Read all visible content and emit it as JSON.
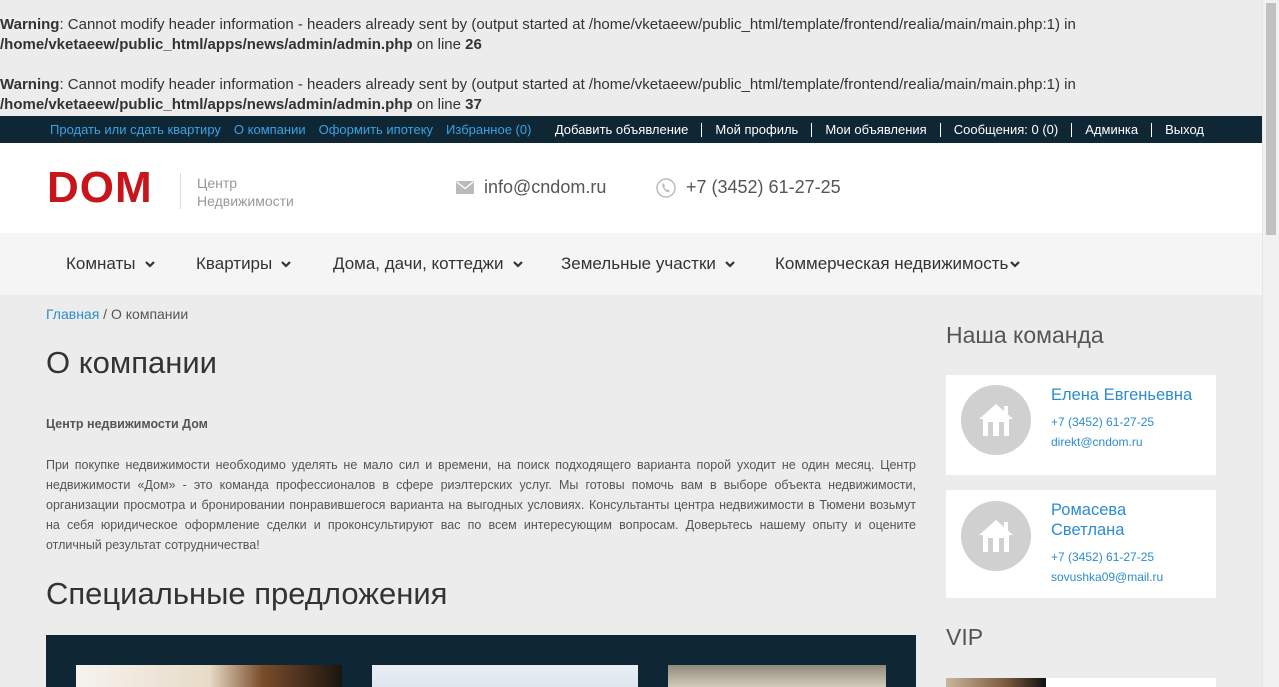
{
  "warnings": [
    {
      "label": "Warning",
      "text": ": Cannot modify header information - headers already sent by (output started at /home/vketaeew/public_html/template/frontend/realia/main/main.php:1) in",
      "path": "/home/vketaeew/public_html/apps/news/admin/admin.php",
      "line_prefix": " on line ",
      "line": "26"
    },
    {
      "label": "Warning",
      "text": ": Cannot modify header information - headers already sent by (output started at /home/vketaeew/public_html/template/frontend/realia/main/main.php:1) in",
      "path": "/home/vketaeew/public_html/apps/news/admin/admin.php",
      "line_prefix": " on line ",
      "line": "37"
    }
  ],
  "topbar": {
    "left_links": [
      "Продать или сдать квартиру",
      "О компании",
      "Оформить ипотеку",
      "Избранное (0)"
    ],
    "right_links": [
      "Добавить объявление",
      "Мой профиль",
      "Мои объявления",
      "Сообщения: 0 (0)",
      "Админка",
      "Выход"
    ]
  },
  "header": {
    "logo": "DOM",
    "logo_sub_1": "Центр",
    "logo_sub_2": "Недвижимости",
    "email": "info@cndom.ru",
    "phone": "+7 (3452) 61-27-25"
  },
  "nav": [
    "Комнаты",
    "Квартиры",
    "Дома, дачи, коттеджи",
    "Земельные участки",
    "Коммерческая недвижимость"
  ],
  "breadcrumb": {
    "home": "Главная",
    "separator": " / ",
    "current": "О компании"
  },
  "main": {
    "title": "О компании",
    "subhead": "Центр недвижимости Дом",
    "paragraph": "При покупке недвижимости необходимо уделять не мало сил и времени, на поиск подходящего варианта порой уходит не один месяц. Центр недвижимости «Дом» - это команда профессионалов в сфере риэлтерских услуг. Мы готовы помочь вам в выборе объекта недвижимости, организации просмотра и бронировании понравившегося варианта на выгодных условиях. Консультанты центра недвижимости в Тюмени возьмут на себя юридическое оформление сделки и проконсультируют вас по всем интересующим вопросам. Доверьтесь нашему опыту и оцените отличный результат сотрудничества!",
    "offers_title": "Специальные предложения"
  },
  "sidebar": {
    "team_title": "Наша команда",
    "team": [
      {
        "name": "Елена Евгеньевна",
        "phone": "+7 (3452) 61-27-25",
        "email": "direkt@cndom.ru"
      },
      {
        "name": "Ромасева Светлана",
        "phone": "+7 (3452) 61-27-25",
        "email": "sovushka09@mail.ru"
      }
    ],
    "vip_title": "VIP"
  },
  "colors": {
    "topbar_bg": "#0f2634",
    "link": "#2d8ccf",
    "logo": "#c8151b"
  }
}
